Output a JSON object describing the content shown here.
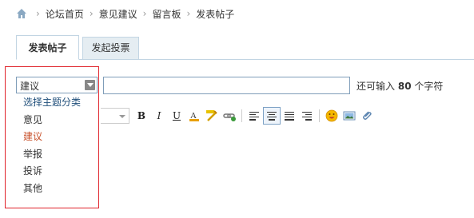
{
  "breadcrumb": {
    "items": [
      "论坛首页",
      "意见建议",
      "留言板",
      "发表帖子"
    ],
    "separator": "›"
  },
  "tabs": {
    "post": "发表帖子",
    "poll": "发起投票"
  },
  "category": {
    "selected": "建议",
    "options": [
      "选择主题分类",
      "意见",
      "建议",
      "举报",
      "投诉",
      "其他"
    ]
  },
  "title_input": {
    "value": ""
  },
  "remain": {
    "prefix": "还可输入",
    "count": "80",
    "suffix": "个字符"
  },
  "toolbar": {
    "bold": "B",
    "italic": "I",
    "underline": "U",
    "fontcolor": "A"
  },
  "colors": {
    "highlight_border": "#e0232b",
    "tab_border": "#c2d5e3",
    "selected_option": "#c8502a"
  }
}
